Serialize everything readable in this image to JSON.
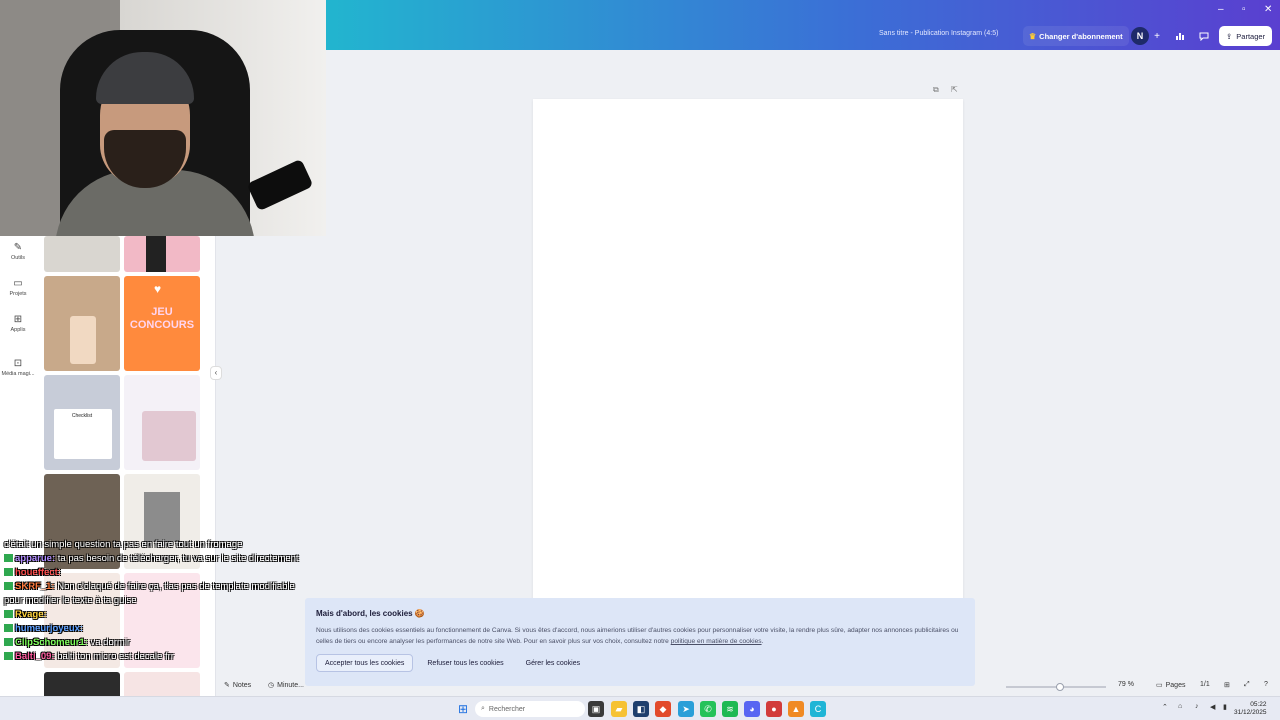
{
  "window": {
    "document_title": "Sans titre - Publication Instagram (4:5)",
    "upgrade_label": "Changer d'abonnement",
    "avatar_initial": "N",
    "share_label": "Partager",
    "controls": [
      "–",
      "▫",
      "✕"
    ]
  },
  "sidebar": {
    "items": [
      {
        "label": "Outils",
        "icon": "wand-icon"
      },
      {
        "label": "Projets",
        "icon": "folder-icon"
      },
      {
        "label": "Applis",
        "icon": "apps-icon"
      },
      {
        "label": "Média magi...",
        "icon": "magic-media-icon"
      }
    ]
  },
  "templates": {
    "items": [
      {
        "text": "",
        "theme": "photo"
      },
      {
        "text": "",
        "theme": "pink-photo"
      },
      {
        "text": "",
        "theme": "perfume"
      },
      {
        "text": "JEU CONCOURS",
        "theme": "orange"
      },
      {
        "text": "Checklist",
        "theme": "checklist"
      },
      {
        "text": "",
        "theme": "calendar"
      },
      {
        "text": "",
        "theme": "bw-photo"
      },
      {
        "text": "",
        "theme": "collage"
      }
    ]
  },
  "cookie_banner": {
    "title": "Mais d'abord, les cookies 🍪",
    "text": "Nous utilisons des cookies essentiels au fonctionnement de Canva. Si vous êtes d'accord, nous aimerions utiliser d'autres cookies pour personnaliser votre visite, la rendre plus sûre, adapter nos annonces publicitaires ou celles de tiers ou encore analyser les performances de notre site Web. Pour en savoir plus sur vos choix, consultez notre ",
    "link_text": "politique en matière de cookies",
    "text_end": ".",
    "accept_label": "Accepter tous les cookies",
    "refuse_label": "Refuser tous les cookies",
    "manage_label": "Gérer les cookies"
  },
  "status_bar": {
    "notes_label": "Notes",
    "timer_label": "Minute...",
    "zoom": "79 %",
    "zoom_fraction": 0.54,
    "pages_label": "Pages",
    "page_count": "1/1"
  },
  "chat": {
    "lines": [
      {
        "user": "",
        "text": "c'était un simple question ta pas en faire tout un fromage",
        "color": "#ffffff"
      },
      {
        "user": "apparue:",
        "text": " ta pas besoin de télécharger, tu va sur le site directement",
        "color": "#b08cff"
      },
      {
        "user": "houeffect:",
        "text": "",
        "color": "#ff4b4b"
      },
      {
        "user": "SKRF_1:",
        "text": " Non c'claqué de faire ça, t'as pas de template modifiable pour modifier le texte à ta guise",
        "color": "#ff7a3d"
      },
      {
        "user": "Rvage:",
        "text": "",
        "color": "#ffd23a"
      },
      {
        "user": "humeurjoyeux:",
        "text": "",
        "color": "#5da0ff"
      },
      {
        "user": "ClipSchomeur1:",
        "text": " va dormir",
        "color": "#7dff5a"
      },
      {
        "user": "Balti_09:",
        "text": " balti ton micro est decale frr",
        "color": "#ff5a9e"
      }
    ]
  },
  "taskbar": {
    "search_placeholder": "Rechercher",
    "time": "05:22",
    "date": "31/12/2025"
  }
}
